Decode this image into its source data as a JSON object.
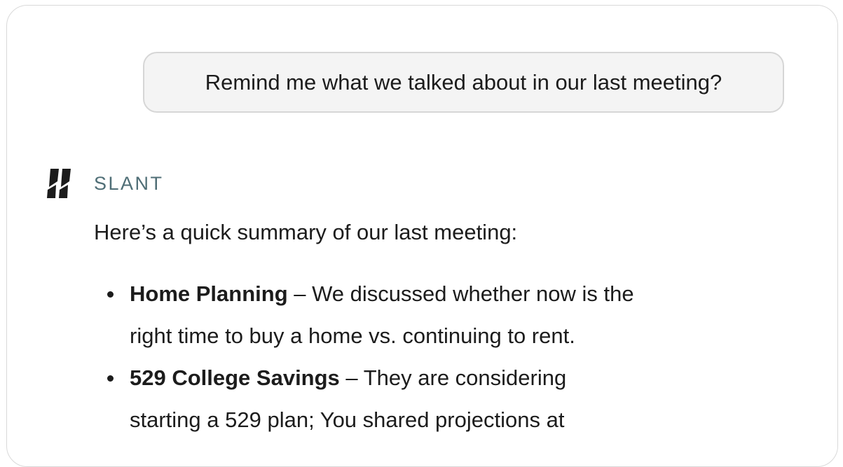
{
  "user_message": "Remind me what we talked about in our last meeting?",
  "assistant": {
    "name": "SLANT",
    "logo_icon": "slant-logo-icon",
    "brand_color": "#4f6e76",
    "intro": "Here’s a quick summary of our last meeting:",
    "bullets": [
      {
        "title": "Home Planning",
        "line1": " – We discussed whether now is the",
        "line2": "right time to buy a home vs. continuing to rent."
      },
      {
        "title": "529 College Savings",
        "line1": " – They are considering",
        "line2": "starting a 529 plan; You shared projections at"
      }
    ]
  }
}
